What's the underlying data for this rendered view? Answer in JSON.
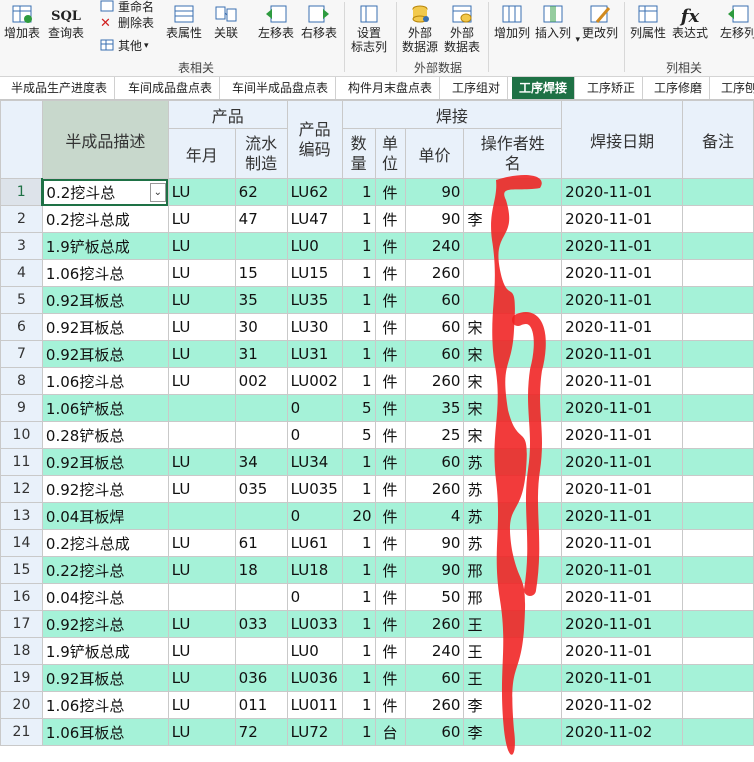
{
  "ribbon": {
    "buttons": [
      {
        "label": "增加表",
        "icon": "add-table-icon"
      },
      {
        "label": "查询表",
        "icon": "sql-icon",
        "icon_text": "SQL"
      },
      {
        "label": "表属性",
        "icon": "table-properties-icon"
      },
      {
        "label": "关联",
        "icon": "link-icon"
      },
      {
        "label": "左移表",
        "icon": "move-left-icon"
      },
      {
        "label": "右移表",
        "icon": "move-right-icon"
      },
      {
        "label": "设置\n标志列",
        "icon": "flag-column-icon"
      },
      {
        "label": "外部\n数据源",
        "icon": "external-source-icon"
      },
      {
        "label": "外部\n数据表",
        "icon": "external-table-icon"
      },
      {
        "label": "增加列",
        "icon": "add-column-icon"
      },
      {
        "label": "插入列",
        "icon": "insert-column-icon"
      },
      {
        "label": "更改列",
        "icon": "edit-column-icon"
      },
      {
        "label": "列属性",
        "icon": "column-properties-icon"
      },
      {
        "label": "表达式",
        "icon": "expression-icon",
        "icon_text": "fx"
      },
      {
        "label": "左移列",
        "icon": "move-column-left-icon"
      }
    ],
    "small": [
      {
        "label": "重命名",
        "icon": "rename-icon"
      },
      {
        "label": "删除表",
        "icon": "delete-table-icon"
      },
      {
        "label": "其他",
        "icon": "other-icon"
      }
    ],
    "groups": [
      "表相关",
      "外部数据",
      "列相关"
    ]
  },
  "tabs": [
    "半成品生产进度表",
    "车间成品盘点表",
    "车间半成品盘点表",
    "构件月末盘点表",
    "工序组对",
    "工序焊接",
    "工序矫正",
    "工序修磨",
    "工序刨"
  ],
  "active_tab": 5,
  "columns": {
    "group_product": "产品",
    "group_weld": "焊接",
    "desc": "半成品描述",
    "year_month": "年月",
    "serial": "流水\n制造",
    "code": "产品\n编码",
    "qty": "数\n量",
    "unit": "单\n位",
    "price": "单价",
    "operator": "操作者姓\n名",
    "date": "焊接日期",
    "remark": "备注"
  },
  "colors": {
    "active_tab": "#1e7145",
    "odd_row": "#a5f2d8",
    "scribble": "#f02020"
  },
  "rows": [
    {
      "n": "1",
      "desc": "0.2挖斗总",
      "ym": "LU",
      "serial": "62",
      "code": "LU62",
      "qty": "1",
      "unit": "件",
      "price": "90",
      "op": "",
      "date": "2020-11-01"
    },
    {
      "n": "2",
      "desc": "0.2挖斗总成",
      "ym": "LU",
      "serial": "47",
      "code": "LU47",
      "qty": "1",
      "unit": "件",
      "price": "90",
      "op": "李",
      "date": "2020-11-01"
    },
    {
      "n": "3",
      "desc": "1.9铲板总成",
      "ym": "LU",
      "serial": "",
      "code": "LU0",
      "qty": "1",
      "unit": "件",
      "price": "240",
      "op": "",
      "date": "2020-11-01"
    },
    {
      "n": "4",
      "desc": "1.06挖斗总",
      "ym": "LU",
      "serial": "15",
      "code": "LU15",
      "qty": "1",
      "unit": "件",
      "price": "260",
      "op": "",
      "date": "2020-11-01"
    },
    {
      "n": "5",
      "desc": "0.92耳板总",
      "ym": "LU",
      "serial": "35",
      "code": "LU35",
      "qty": "1",
      "unit": "件",
      "price": "60",
      "op": "",
      "date": "2020-11-01"
    },
    {
      "n": "6",
      "desc": "0.92耳板总",
      "ym": "LU",
      "serial": "30",
      "code": "LU30",
      "qty": "1",
      "unit": "件",
      "price": "60",
      "op": "宋",
      "date": "2020-11-01"
    },
    {
      "n": "7",
      "desc": "0.92耳板总",
      "ym": "LU",
      "serial": "31",
      "code": "LU31",
      "qty": "1",
      "unit": "件",
      "price": "60",
      "op": "宋",
      "date": "2020-11-01"
    },
    {
      "n": "8",
      "desc": "1.06挖斗总",
      "ym": "LU",
      "serial": "002",
      "code": "LU002",
      "qty": "1",
      "unit": "件",
      "price": "260",
      "op": "宋",
      "date": "2020-11-01"
    },
    {
      "n": "9",
      "desc": "1.06铲板总",
      "ym": "",
      "serial": "",
      "code": "0",
      "qty": "5",
      "unit": "件",
      "price": "35",
      "op": "宋",
      "date": "2020-11-01"
    },
    {
      "n": "10",
      "desc": "0.28铲板总",
      "ym": "",
      "serial": "",
      "code": "0",
      "qty": "5",
      "unit": "件",
      "price": "25",
      "op": "宋",
      "date": "2020-11-01"
    },
    {
      "n": "11",
      "desc": "0.92耳板总",
      "ym": "LU",
      "serial": "34",
      "code": "LU34",
      "qty": "1",
      "unit": "件",
      "price": "60",
      "op": "苏",
      "date": "2020-11-01"
    },
    {
      "n": "12",
      "desc": "0.92挖斗总",
      "ym": "LU",
      "serial": "035",
      "code": "LU035",
      "qty": "1",
      "unit": "件",
      "price": "260",
      "op": "苏",
      "date": "2020-11-01"
    },
    {
      "n": "13",
      "desc": "0.04耳板焊",
      "ym": "",
      "serial": "",
      "code": "0",
      "qty": "20",
      "unit": "件",
      "price": "4",
      "op": "苏",
      "date": "2020-11-01"
    },
    {
      "n": "14",
      "desc": "0.2挖斗总成",
      "ym": "LU",
      "serial": "61",
      "code": "LU61",
      "qty": "1",
      "unit": "件",
      "price": "90",
      "op": "苏",
      "date": "2020-11-01"
    },
    {
      "n": "15",
      "desc": "0.22挖斗总",
      "ym": "LU",
      "serial": "18",
      "code": "LU18",
      "qty": "1",
      "unit": "件",
      "price": "90",
      "op": "邢",
      "date": "2020-11-01"
    },
    {
      "n": "16",
      "desc": "0.04挖斗总",
      "ym": "",
      "serial": "",
      "code": "0",
      "qty": "1",
      "unit": "件",
      "price": "50",
      "op": "邢",
      "date": "2020-11-01"
    },
    {
      "n": "17",
      "desc": "0.92挖斗总",
      "ym": "LU",
      "serial": "033",
      "code": "LU033",
      "qty": "1",
      "unit": "件",
      "price": "260",
      "op": "王",
      "date": "2020-11-01"
    },
    {
      "n": "18",
      "desc": "1.9铲板总成",
      "ym": "LU",
      "serial": "",
      "code": "LU0",
      "qty": "1",
      "unit": "件",
      "price": "240",
      "op": "王",
      "date": "2020-11-01"
    },
    {
      "n": "19",
      "desc": "0.92耳板总",
      "ym": "LU",
      "serial": "036",
      "code": "LU036",
      "qty": "1",
      "unit": "件",
      "price": "60",
      "op": "王",
      "date": "2020-11-01"
    },
    {
      "n": "20",
      "desc": "1.06挖斗总",
      "ym": "LU",
      "serial": "011",
      "code": "LU011",
      "qty": "1",
      "unit": "件",
      "price": "260",
      "op": "李",
      "date": "2020-11-02"
    },
    {
      "n": "21",
      "desc": "1.06耳板总",
      "ym": "LU",
      "serial": "72",
      "code": "LU72",
      "qty": "1",
      "unit": "台",
      "price": "60",
      "op": "李",
      "date": "2020-11-02"
    }
  ]
}
